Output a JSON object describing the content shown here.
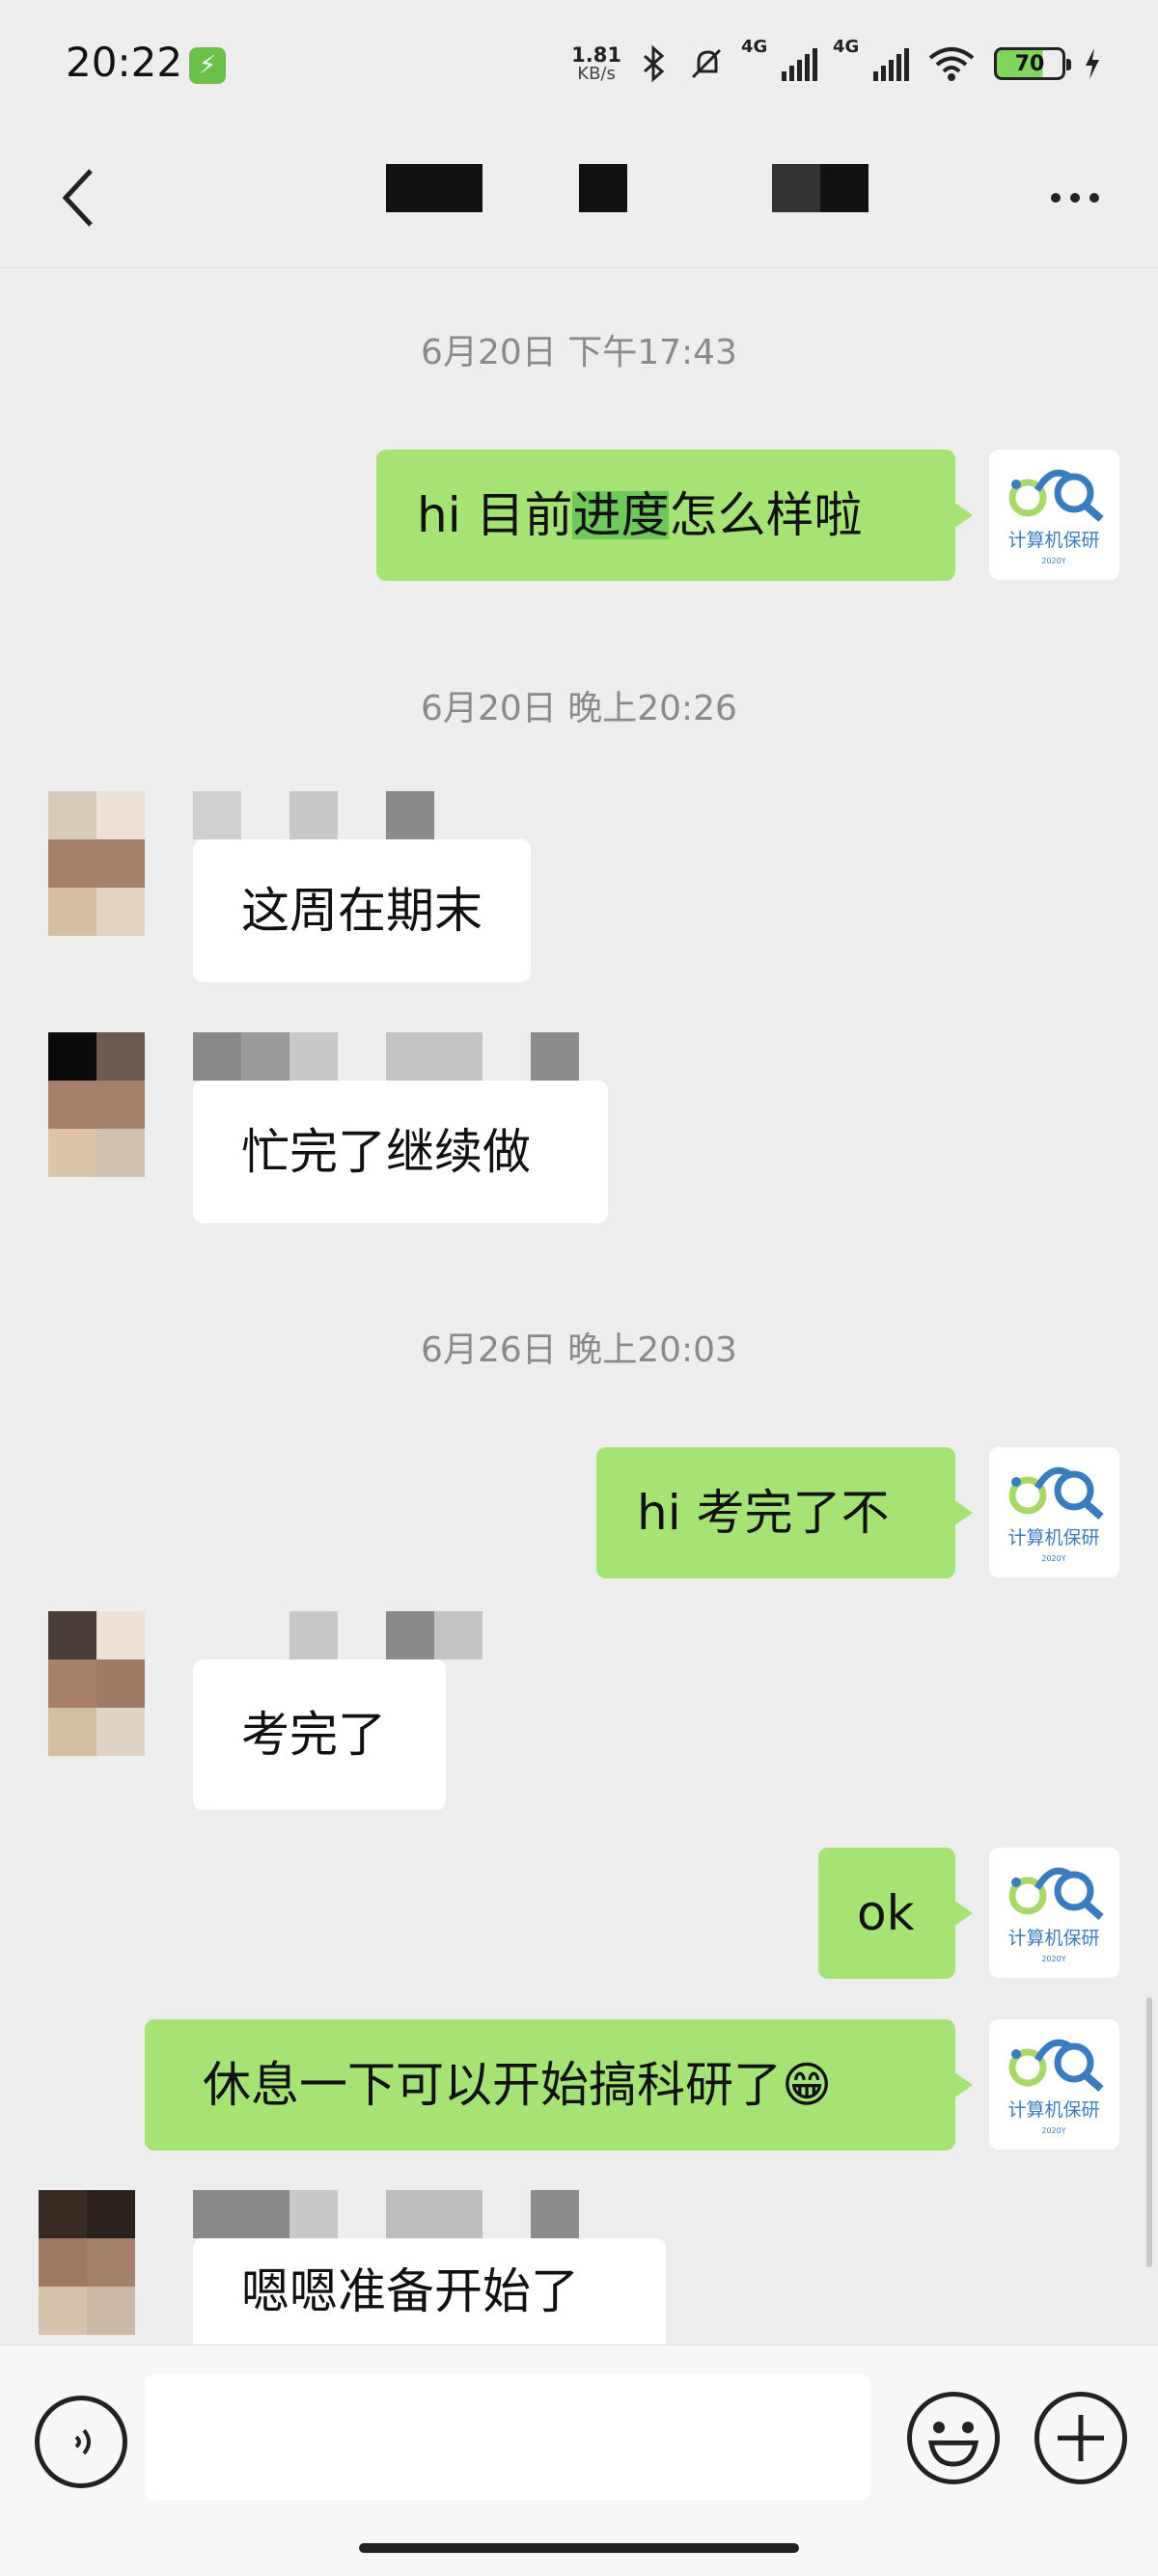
{
  "status_bar": {
    "time": "20:22",
    "net_speed_value": "1.81",
    "net_speed_unit": "KB/s",
    "signal1_label": "4G",
    "signal2_label": "4G",
    "battery_level": "70"
  },
  "header": {
    "title_redacted": true
  },
  "messages": [
    {
      "type": "timestamp",
      "text": "6月20日 下午17:43"
    },
    {
      "type": "outgoing",
      "text_before": "hi 目前",
      "text_highlight": "进度",
      "text_after": "怎么样啦"
    },
    {
      "type": "timestamp",
      "text": "6月20日 晚上20:26"
    },
    {
      "type": "incoming",
      "text": "这周在期末"
    },
    {
      "type": "incoming",
      "text": "忙完了继续做"
    },
    {
      "type": "timestamp",
      "text": "6月26日 晚上20:03"
    },
    {
      "type": "outgoing",
      "text": "hi 考完了不"
    },
    {
      "type": "incoming",
      "text": "考完了"
    },
    {
      "type": "outgoing",
      "text": "ok"
    },
    {
      "type": "outgoing",
      "text": "休息一下可以开始搞科研了",
      "emoji": "😁"
    },
    {
      "type": "incoming",
      "text": "嗯嗯准备开始了"
    }
  ],
  "self_avatar": {
    "label": "计算机保研",
    "sublabel": "2020Y"
  },
  "input": {
    "value": "",
    "placeholder": ""
  },
  "colors": {
    "outgoing_bubble": "#a5e374",
    "incoming_bubble": "#ffffff",
    "background": "#ededed"
  }
}
